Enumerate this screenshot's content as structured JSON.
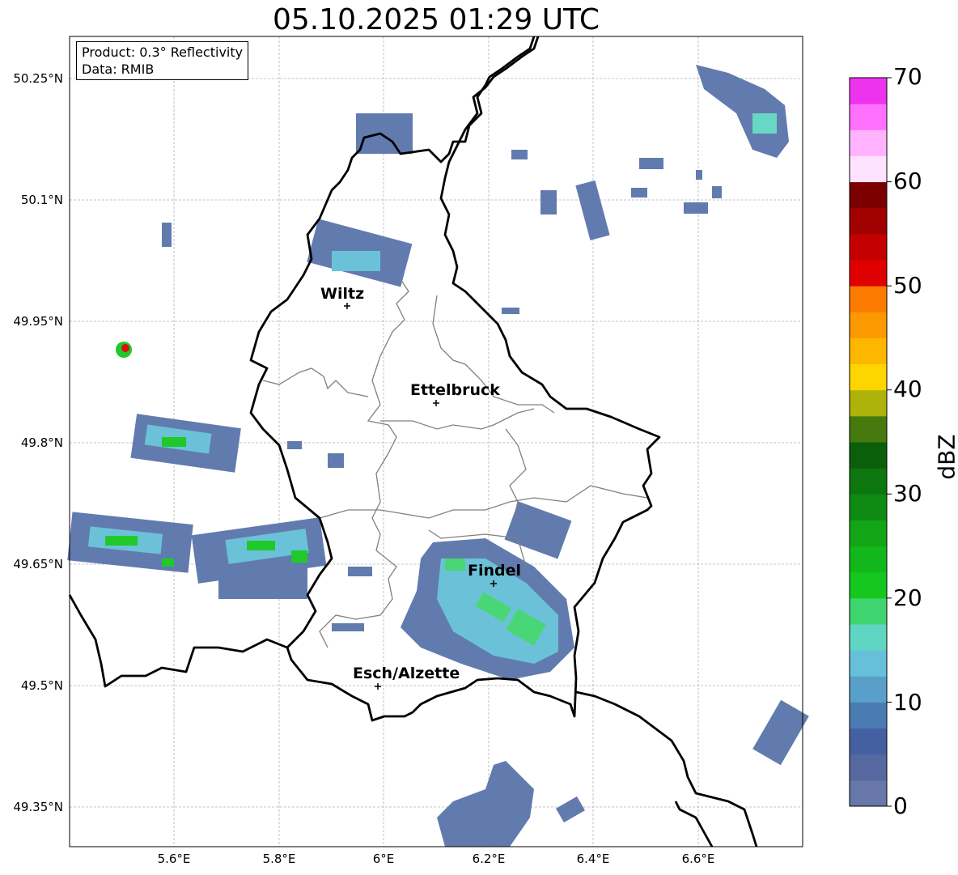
{
  "title": "05.10.2025 01:29 UTC",
  "info": {
    "product": "Product: 0.3° Reflectivity",
    "data": "Data: RMIB"
  },
  "lat_ticks": [
    "50.25°N",
    "50.1°N",
    "49.95°N",
    "49.8°N",
    "49.65°N",
    "49.5°N",
    "49.35°N"
  ],
  "lon_ticks": [
    "5.6°E",
    "5.8°E",
    "6°E",
    "6.2°E",
    "6.4°E",
    "6.6°E"
  ],
  "cities": [
    {
      "name": "Wiltz"
    },
    {
      "name": "Ettelbruck"
    },
    {
      "name": "Findel"
    },
    {
      "name": "Esch/Alzette"
    }
  ],
  "colorbar": {
    "label": "dBZ",
    "ticks": [
      "0",
      "10",
      "20",
      "30",
      "40",
      "50",
      "60",
      "70"
    ],
    "colors": [
      "#6677a8",
      "#5568a0",
      "#4560a2",
      "#4a7bb3",
      "#58a0c9",
      "#66c0d9",
      "#5fd6c2",
      "#40d470",
      "#15c71f",
      "#12b81b",
      "#12a515",
      "#0f8a12",
      "#0d760e",
      "#0b5f0b",
      "#467a0e",
      "#adb30a",
      "#ffd500",
      "#fdb700",
      "#fd9900",
      "#fd7a00",
      "#e00000",
      "#c40000",
      "#a00000",
      "#7a0000",
      "#ffe2ff",
      "#ffb3ff",
      "#ff70ff",
      "#ee33ee"
    ]
  },
  "colors": {
    "border": "#000000",
    "canton": "#808080",
    "grid": "#b3b3b3"
  }
}
